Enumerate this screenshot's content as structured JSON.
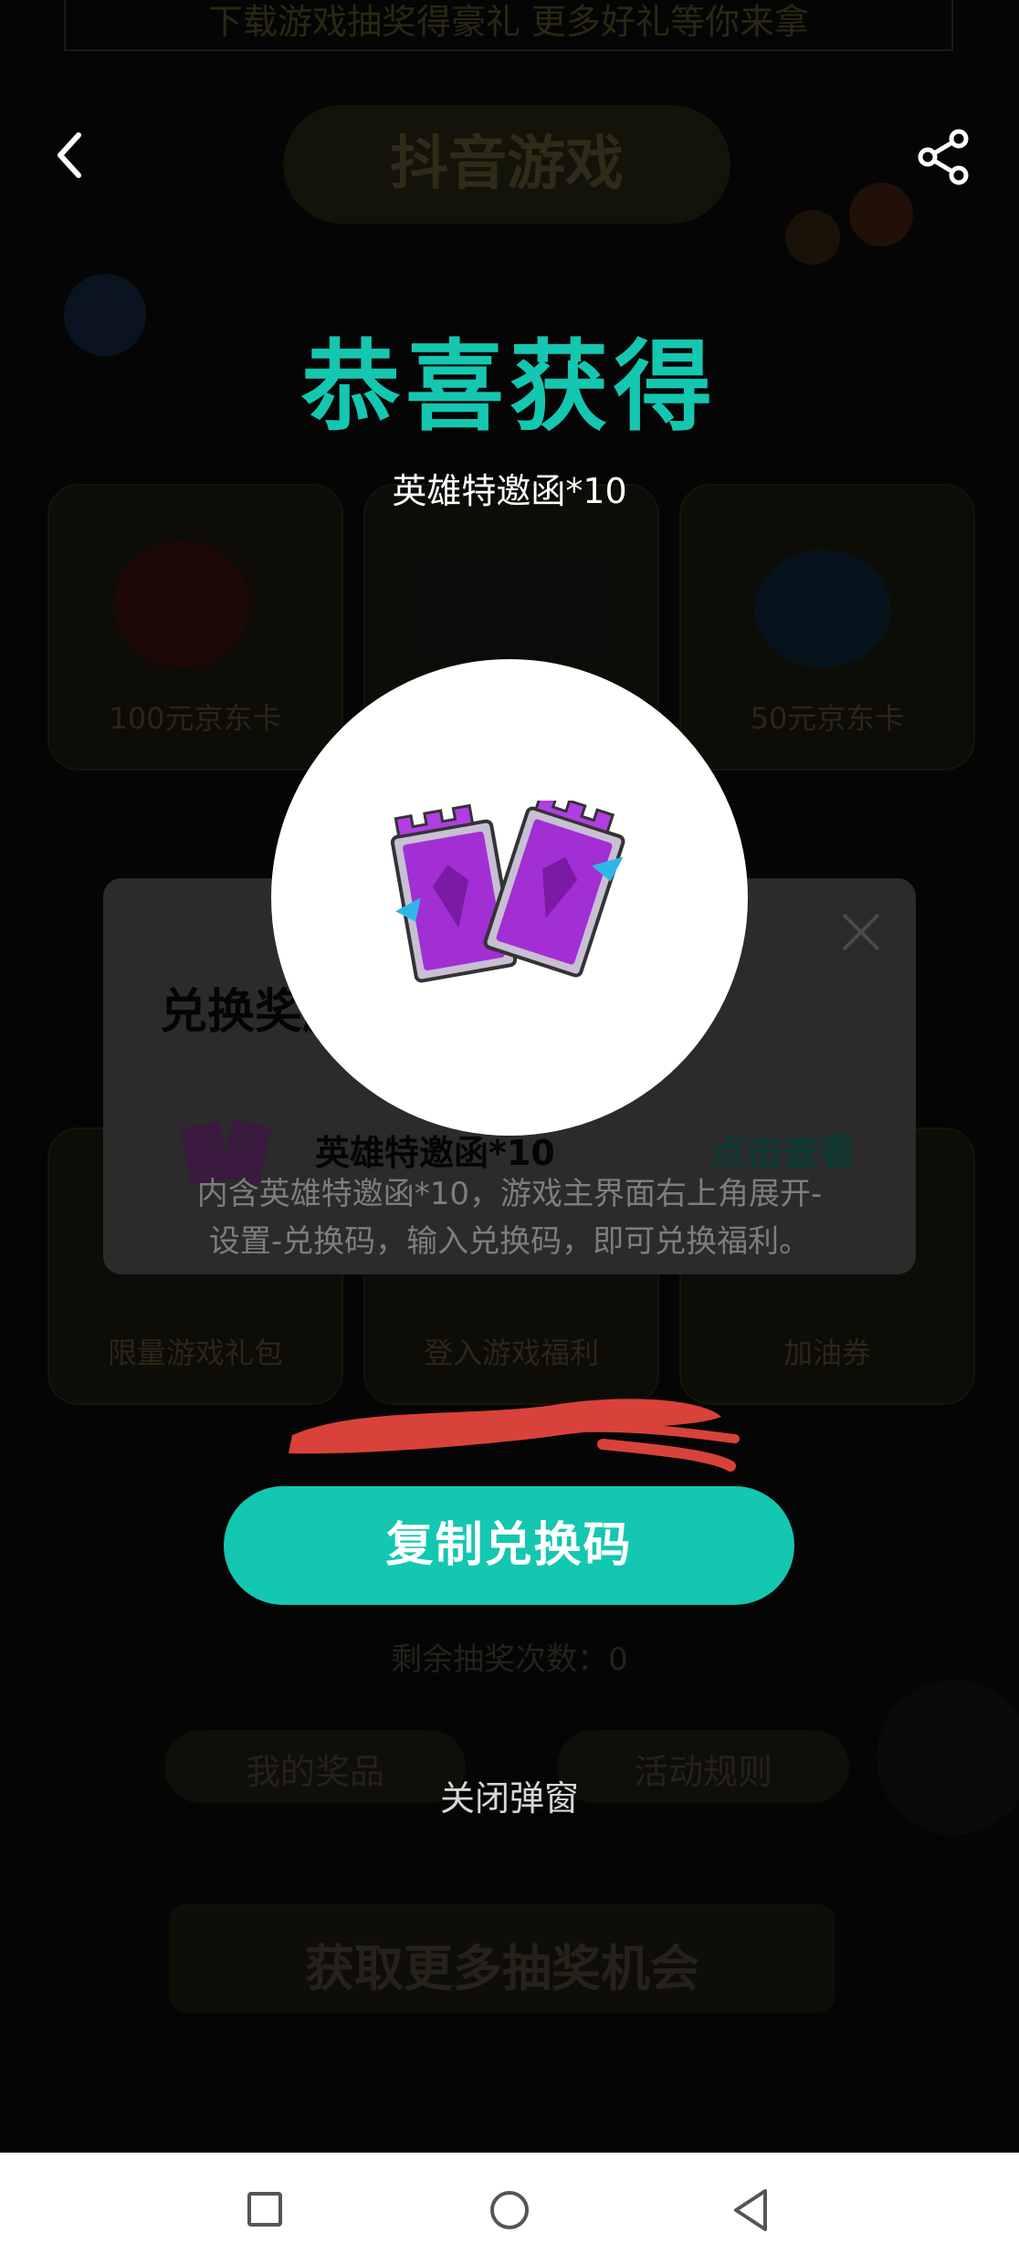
{
  "background": {
    "banner_text": "下载游戏抽奖得豪礼 更多好礼等你来拿",
    "title_pill": "抖音游戏",
    "cards": [
      {
        "label": "100元京东卡"
      },
      {
        "label": ""
      },
      {
        "label": "50元京东卡"
      },
      {
        "label": "限量游戏礼包"
      },
      {
        "label": "登入游戏福利"
      },
      {
        "label": "加油券"
      }
    ],
    "remaining_text": "剩余抽奖次数：0",
    "bottom_buttons": [
      "我的奖品",
      "活动规则"
    ],
    "more_chances": "获取更多抽奖机会"
  },
  "redeem_modal": {
    "title": "兑换奖励",
    "item_name": "英雄特邀函*10",
    "view_link": "点击查看",
    "description_line1": "内含英雄特邀函*10，游戏主界面右上角展开-",
    "description_line2": "设置-兑换码，输入兑换码，即可兑换福利。"
  },
  "popup": {
    "title": "恭喜获得",
    "prize": "英雄特邀函*10",
    "copy_button": "复制兑换码",
    "close_label": "关闭弹窗"
  },
  "icons": {
    "back": "back-arrow-icon",
    "share": "share-icon",
    "close": "close-icon",
    "nav_recent": "recent-apps-icon",
    "nav_home": "home-icon",
    "nav_back": "nav-back-icon"
  },
  "colors": {
    "accent": "#14c7b0",
    "overlay": "#000000",
    "redacted": "#d9423a"
  }
}
